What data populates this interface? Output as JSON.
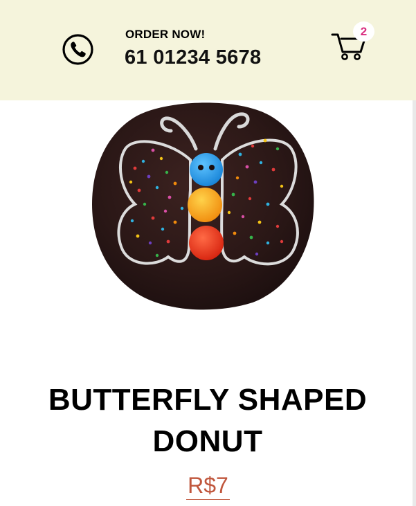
{
  "header": {
    "order_label": "ORDER NOW!",
    "phone_number": "61 01234 5678",
    "phone_icon": "phone-icon",
    "cart_icon": "shopping-cart-icon",
    "cart_count": "2",
    "background_color": "#f5f4dc",
    "badge_color": "#d92c7f"
  },
  "product": {
    "title": "BUTTERFLY SHAPED DONUT",
    "price": "R$7",
    "price_color": "#c0563c",
    "image": "donut-image"
  }
}
